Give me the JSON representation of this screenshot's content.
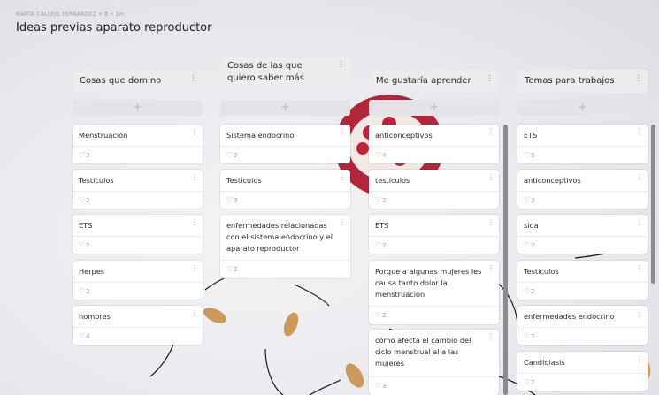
{
  "header": {
    "meta": "MARTA CALLEJO FERNÁNDEZ + 8 • 1m",
    "title": "Ideas previas aparato reproductor"
  },
  "colors": {
    "card": "#ffffff",
    "column_header": "#ececef",
    "add_bar": "#e4e4e8",
    "accent_seed": "#c99a5a",
    "pomegranate": "#b3263a"
  },
  "columns": [
    {
      "title": "Cosas que domino",
      "add_label": "+",
      "cards": [
        {
          "text": "Menstruación",
          "likes": "2"
        },
        {
          "text": "Testiculos",
          "likes": "2"
        },
        {
          "text": "ETS",
          "likes": "2"
        },
        {
          "text": "Herpes",
          "likes": "2"
        },
        {
          "text": "hombres",
          "likes": "4"
        }
      ]
    },
    {
      "title": "Cosas de las que quiero saber más",
      "add_label": "+",
      "cards": [
        {
          "text": "Sistema endocrino",
          "likes": "2"
        },
        {
          "text": "Testiculos",
          "likes": "3"
        },
        {
          "text": "enfermedades relacionadas con el sistema endocrino y el aparato reproductor",
          "likes": "2"
        }
      ]
    },
    {
      "title": "Me gustaría aprender",
      "add_label": "+",
      "cards": [
        {
          "text": "anticonceptivos",
          "likes": "4"
        },
        {
          "text": "testiculos",
          "likes": "2"
        },
        {
          "text": "ETS",
          "likes": "2"
        },
        {
          "text": "Porque a algunas mujeres les causa tanto dolor la menstruación",
          "likes": "2"
        },
        {
          "text": "cómo afecta el cambio del ciclo menstrual al a las mujeres",
          "likes": "3"
        }
      ]
    },
    {
      "title": "Temas para trabajos",
      "add_label": "+",
      "cards": [
        {
          "text": "ETS",
          "likes": "5"
        },
        {
          "text": "anticonceptivos",
          "likes": "3"
        },
        {
          "text": "sida",
          "likes": "2"
        },
        {
          "text": "Testiculos",
          "likes": "2"
        },
        {
          "text": "enfermedades endocrino",
          "likes": "2"
        },
        {
          "text": "Candidiasis",
          "likes": "2"
        }
      ]
    }
  ],
  "icons": {
    "column_menu": "more-vertical-icon",
    "card_menu": "more-vertical-icon",
    "like": "heart-icon"
  }
}
